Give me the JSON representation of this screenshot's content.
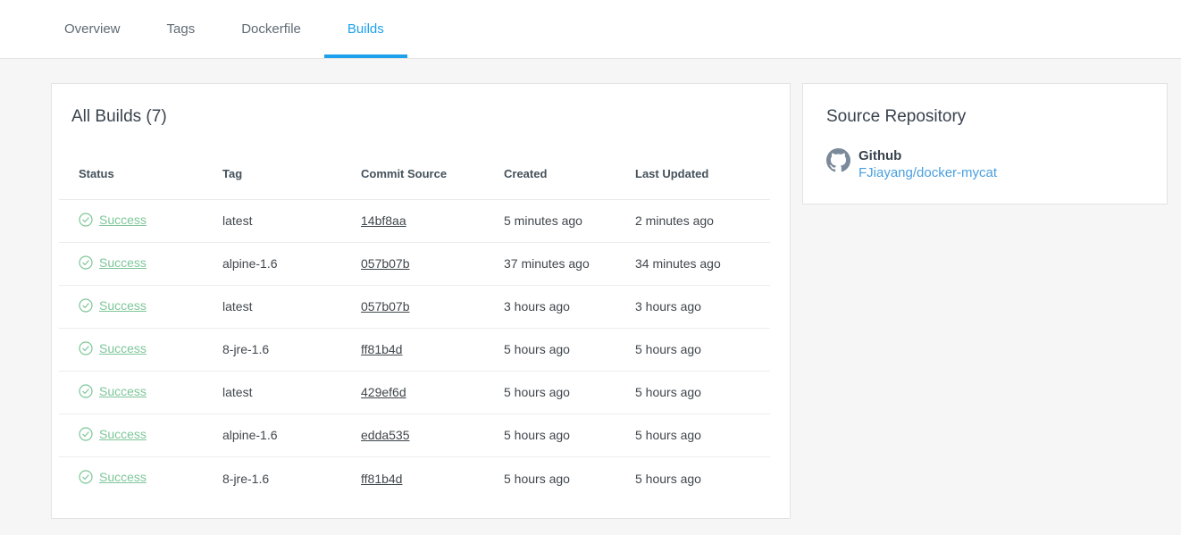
{
  "tabs": [
    {
      "label": "Overview",
      "active": false
    },
    {
      "label": "Tags",
      "active": false
    },
    {
      "label": "Dockerfile",
      "active": false
    },
    {
      "label": "Builds",
      "active": true
    }
  ],
  "builds_panel": {
    "title": "All Builds (7)",
    "columns": [
      "Status",
      "Tag",
      "Commit Source",
      "Created",
      "Last Updated"
    ],
    "rows": [
      {
        "status": "Success",
        "tag": "latest",
        "commit": "14bf8aa",
        "created": "5 minutes ago",
        "updated": "2 minutes ago"
      },
      {
        "status": "Success",
        "tag": "alpine-1.6",
        "commit": "057b07b",
        "created": "37 minutes ago",
        "updated": "34 minutes ago"
      },
      {
        "status": "Success",
        "tag": "latest",
        "commit": "057b07b",
        "created": "3 hours ago",
        "updated": "3 hours ago"
      },
      {
        "status": "Success",
        "tag": "8-jre-1.6",
        "commit": "ff81b4d",
        "created": "5 hours ago",
        "updated": "5 hours ago"
      },
      {
        "status": "Success",
        "tag": "latest",
        "commit": "429ef6d",
        "created": "5 hours ago",
        "updated": "5 hours ago"
      },
      {
        "status": "Success",
        "tag": "alpine-1.6",
        "commit": "edda535",
        "created": "5 hours ago",
        "updated": "5 hours ago"
      },
      {
        "status": "Success",
        "tag": "8-jre-1.6",
        "commit": "ff81b4d",
        "created": "5 hours ago",
        "updated": "5 hours ago"
      }
    ]
  },
  "source_repository": {
    "title": "Source Repository",
    "provider": "Github",
    "repo": "FJiayang/docker-mycat",
    "icon": "github-icon"
  },
  "colors": {
    "accent_blue": "#1da1ec",
    "success_green": "#7ec699",
    "link_blue": "#4a9fdf"
  }
}
